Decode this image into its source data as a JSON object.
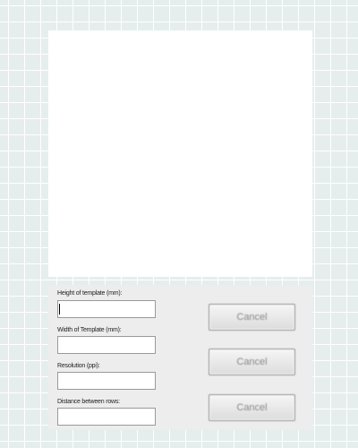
{
  "form": {
    "height_label": "Height of template (mm):",
    "height_value": "",
    "width_label": "Width of Template (mm):",
    "width_value": "",
    "resolution_label": "Resolution (ppi):",
    "resolution_value": "",
    "distance_label": "Distance between rows:",
    "distance_value": ""
  },
  "buttons": [
    {
      "label": "Cancel"
    },
    {
      "label": "Cancel"
    },
    {
      "label": "Cancel"
    }
  ]
}
